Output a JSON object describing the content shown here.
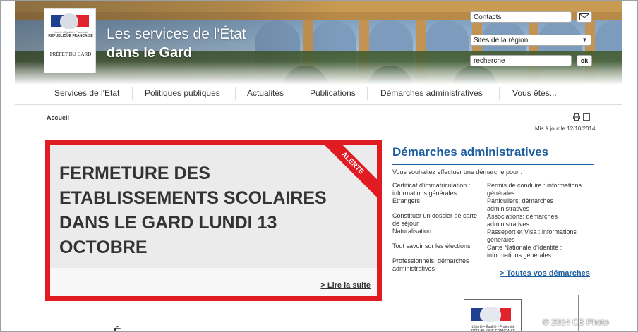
{
  "header": {
    "logo": {
      "motto": "Liberté • Égalité • Fraternité",
      "republic": "RÉPUBLIQUE FRANÇAISE",
      "prefect": "PRÉFET DU GARD"
    },
    "title_line1": "Les services de l'État",
    "title_line2": "dans le Gard",
    "contacts_label": "Contacts",
    "sites_select": "Sites de la région",
    "search_value": "recherche",
    "ok_label": "ok"
  },
  "nav": {
    "items": [
      "Services de l'Etat",
      "Politiques publiques",
      "Actualités",
      "Publications",
      "Démarches administratives",
      "Vous êtes..."
    ]
  },
  "breadcrumb": "Accueil",
  "updated": "Mis à jour le 12/10/2014",
  "alert": {
    "badge": "ALERTE",
    "title": "FERMETURE DES ETABLISSEMENTS SCOLAIRES DANS LE GARD LUNDI 13 OCTOBRE",
    "read_more": "> Lire la suite"
  },
  "demarches": {
    "title": "Démarches administratives",
    "intro": "Vous souhaitez effectuer une démarche pour :",
    "left": [
      "Certificat d'immatriculation : informations générales",
      "Etrangers",
      "Constituer un dossier de carte de séjour",
      "Naturalisation",
      "Tout savoir sur les élections",
      "Professionnels: démarches administratives"
    ],
    "right": [
      "Permis de conduire : informations générales",
      "Particuliers: démarches administratives",
      "Associations: démarches administratives",
      "Passeport et Visa : informations générales",
      "Carte Nationale d'Identité : informations générales"
    ],
    "all_link": "> Toutes vos démarches"
  },
  "promo": {
    "logo_text": "Liberté • Égalité • Fraternité RÉPUBLIQUE FRANÇAISE"
  },
  "bottom_glyph": "É",
  "copyright": "© 2014 CB Photo",
  "colors": {
    "alert_red": "#e01b22",
    "link_blue": "#1c5e9f"
  },
  "icons": [
    "mail-icon",
    "chevron-down-icon",
    "print-icon",
    "share-icon"
  ]
}
